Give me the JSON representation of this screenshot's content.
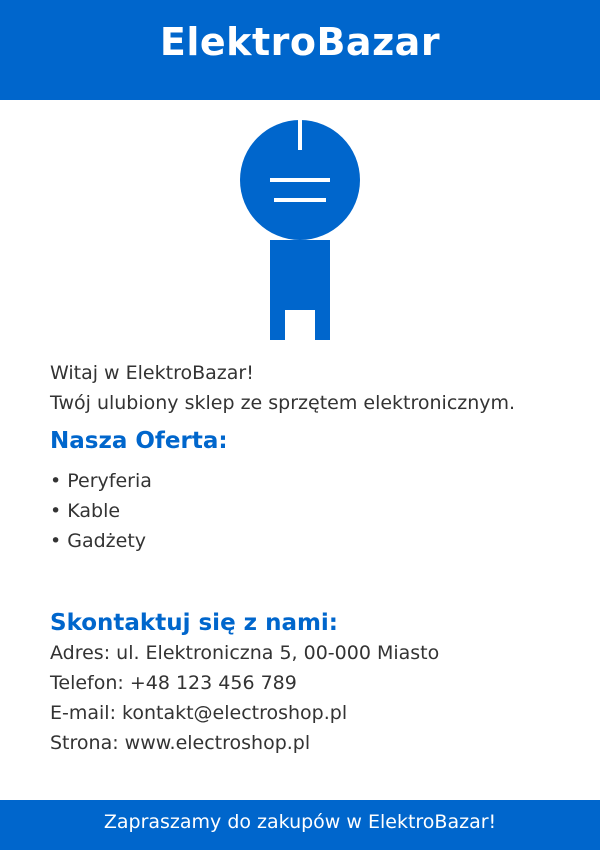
{
  "header": {
    "title": "ElektroBazar"
  },
  "logo": {
    "icon": "plug-figure-icon",
    "color": "#0066cc"
  },
  "intro": {
    "greeting": "Witaj w ElektroBazar!",
    "tagline": "Twój ulubiony sklep ze sprzętem elektronicznym."
  },
  "offer": {
    "title": "Nasza Oferta:",
    "items": [
      "• Peryferia",
      "• Kable",
      "• Gadżety"
    ]
  },
  "contact": {
    "title": "Skontaktuj się z nami:",
    "address": "Adres: ul. Elektroniczna 5, 00-000 Miasto",
    "phone": "Telefon: +48 123 456 789",
    "email": "E-mail: kontakt@electroshop.pl",
    "website": "Strona: www.electroshop.pl"
  },
  "footer": {
    "text": "Zapraszamy do zakupów w ElektroBazar!"
  },
  "colors": {
    "brand": "#0066cc",
    "text": "#333333",
    "background": "#ffffff"
  }
}
